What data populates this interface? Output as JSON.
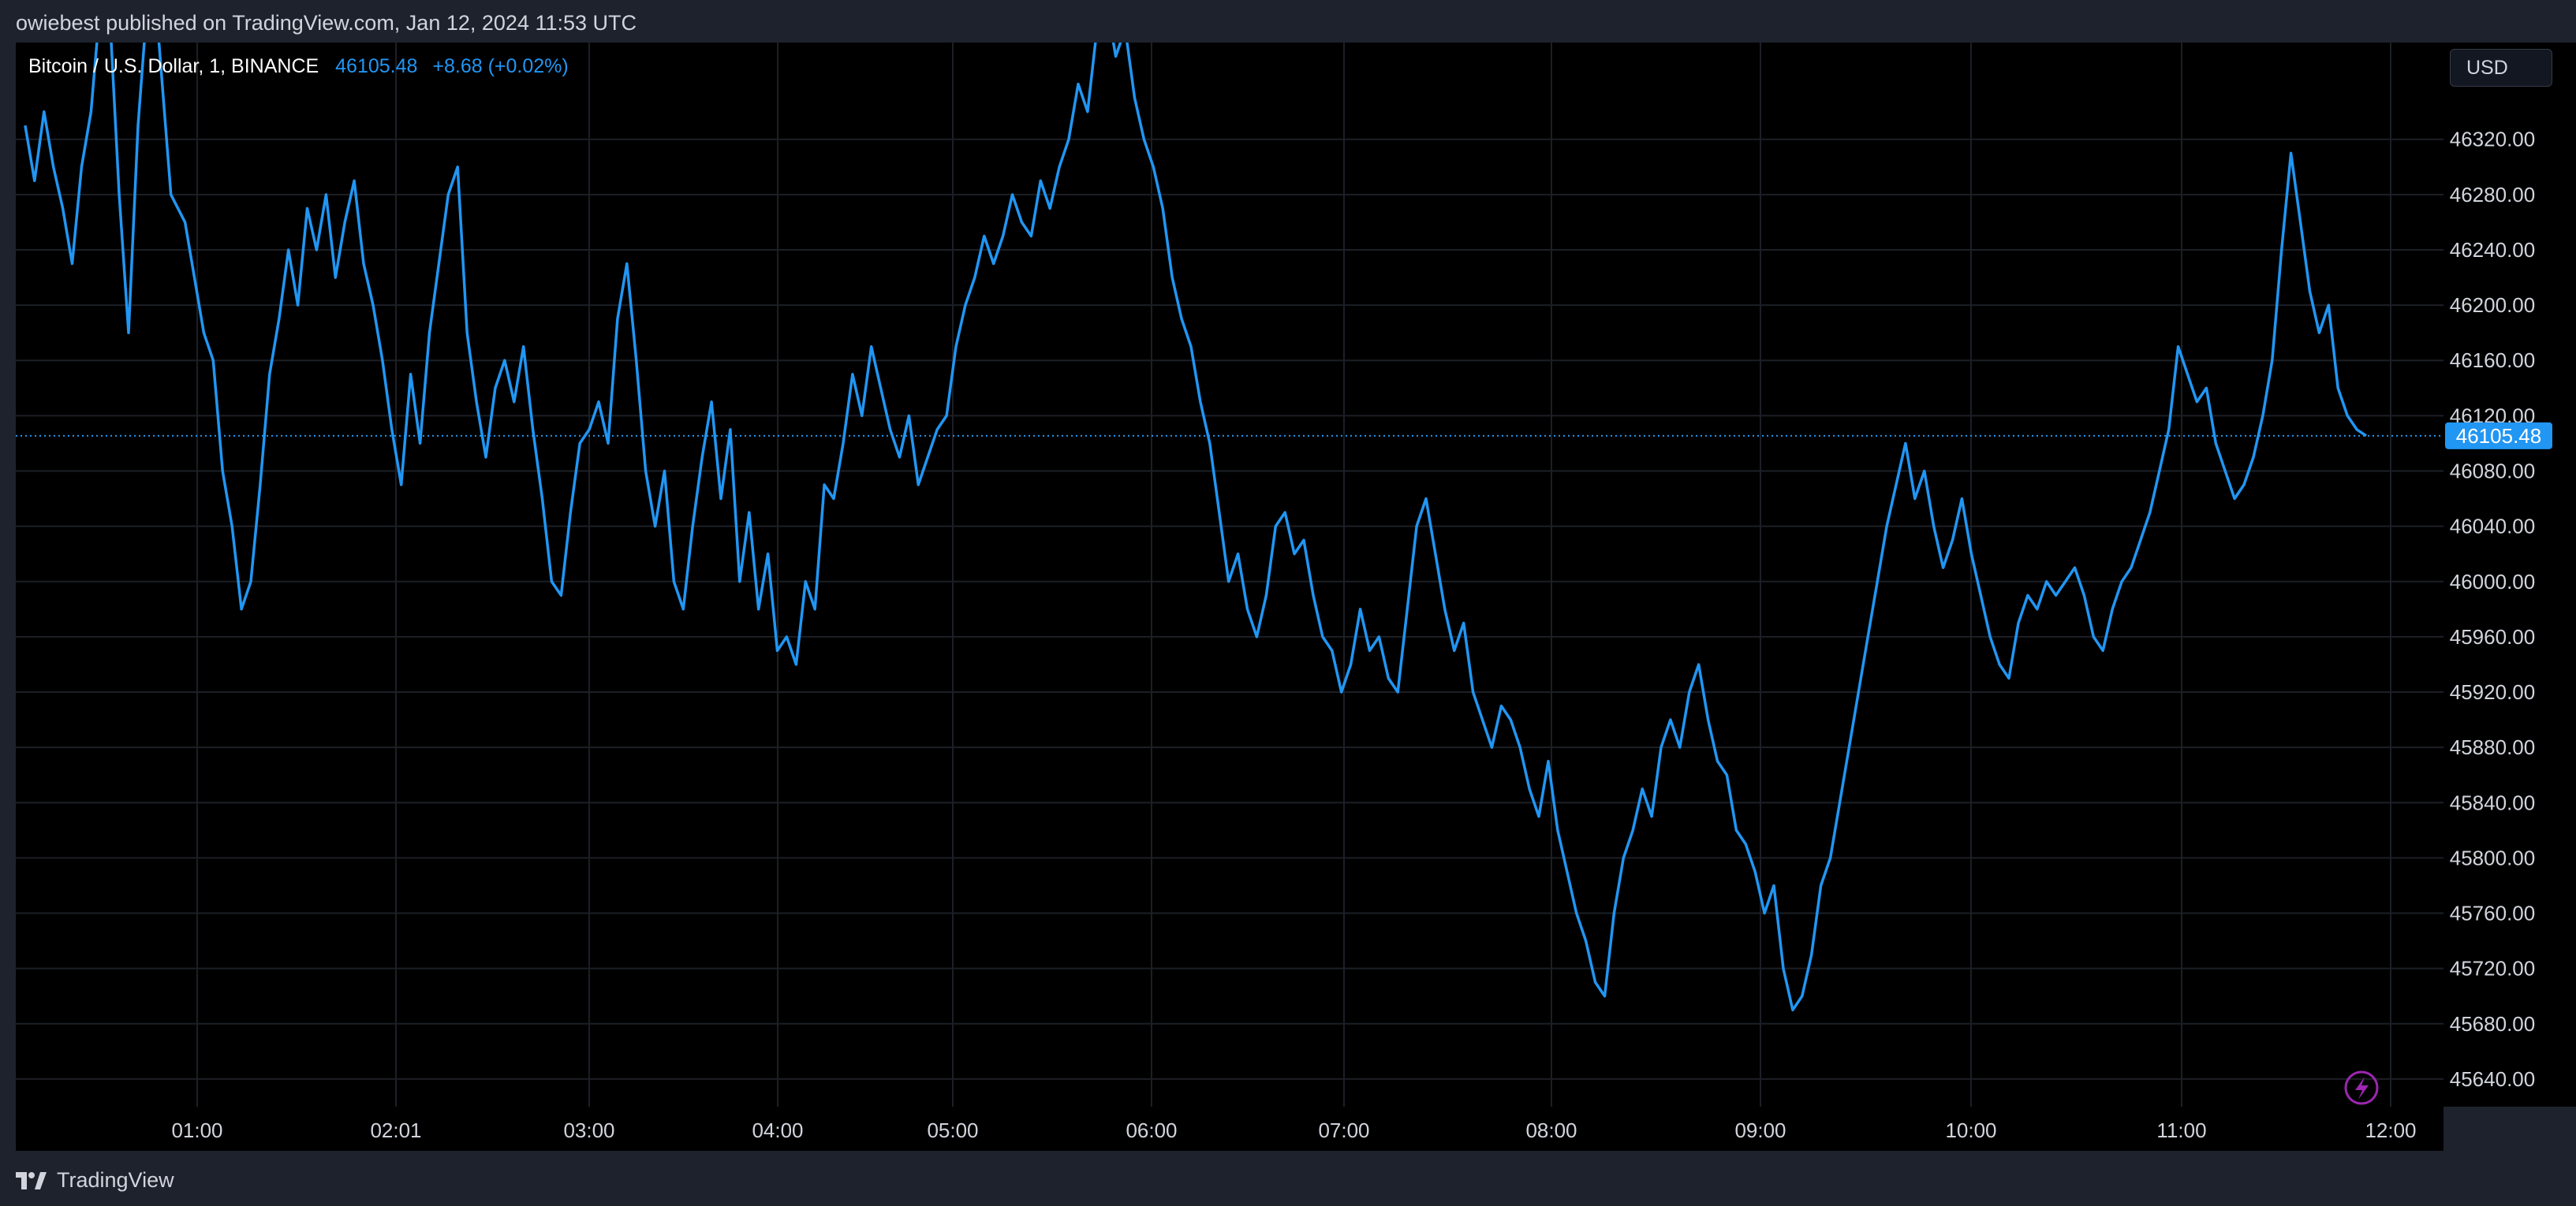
{
  "header": {
    "published": "owiebest published on TradingView.com, Jan 12, 2024 11:53 UTC"
  },
  "legend": {
    "symbol": "Bitcoin / U.S. Dollar, 1, BINANCE",
    "last": "46105.48",
    "change": "+8.68 (+0.02%)"
  },
  "currency_button": "USD",
  "footer": {
    "brand": "TradingView",
    "logo_icon": "tradingview-logo-icon"
  },
  "colors": {
    "line": "#2196f3",
    "grid": "#1c1f26",
    "background": "#000000",
    "badge": "#2196f3"
  },
  "chart_data": {
    "type": "line",
    "series": [
      {
        "values": [
          [
            0.02,
            46330
          ],
          [
            0.04,
            46290
          ],
          [
            0.06,
            46340
          ],
          [
            0.08,
            46300
          ],
          [
            0.1,
            46270
          ],
          [
            0.12,
            46230
          ],
          [
            0.14,
            46300
          ],
          [
            0.16,
            46340
          ],
          [
            0.18,
            46420
          ],
          [
            0.2,
            46410
          ],
          [
            0.22,
            46280
          ],
          [
            0.24,
            46180
          ],
          [
            0.26,
            46330
          ],
          [
            0.28,
            46420
          ],
          [
            0.3,
            46410
          ],
          [
            0.33,
            46280
          ],
          [
            0.36,
            46260
          ],
          [
            0.38,
            46220
          ],
          [
            0.4,
            46180
          ],
          [
            0.42,
            46160
          ],
          [
            0.44,
            46080
          ],
          [
            0.46,
            46040
          ],
          [
            0.48,
            45980
          ],
          [
            0.5,
            46000
          ],
          [
            0.52,
            46070
          ],
          [
            0.54,
            46150
          ],
          [
            0.56,
            46190
          ],
          [
            0.58,
            46240
          ],
          [
            0.6,
            46200
          ],
          [
            0.62,
            46270
          ],
          [
            0.64,
            46240
          ],
          [
            0.66,
            46280
          ],
          [
            0.68,
            46220
          ],
          [
            0.7,
            46260
          ],
          [
            0.72,
            46290
          ],
          [
            0.74,
            46230
          ],
          [
            0.76,
            46200
          ],
          [
            0.78,
            46160
          ],
          [
            0.8,
            46110
          ],
          [
            0.82,
            46070
          ],
          [
            0.84,
            46150
          ],
          [
            0.86,
            46100
          ],
          [
            0.88,
            46180
          ],
          [
            0.9,
            46230
          ],
          [
            0.92,
            46280
          ],
          [
            0.94,
            46300
          ],
          [
            0.96,
            46180
          ],
          [
            0.98,
            46130
          ],
          [
            1.0,
            46090
          ],
          [
            1.02,
            46140
          ],
          [
            1.04,
            46160
          ],
          [
            1.06,
            46130
          ],
          [
            1.08,
            46170
          ],
          [
            1.1,
            46110
          ],
          [
            1.12,
            46060
          ],
          [
            1.14,
            46000
          ],
          [
            1.16,
            45990
          ],
          [
            1.18,
            46050
          ],
          [
            1.2,
            46100
          ],
          [
            1.22,
            46110
          ],
          [
            1.24,
            46130
          ],
          [
            1.26,
            46100
          ],
          [
            1.28,
            46190
          ],
          [
            1.3,
            46230
          ],
          [
            1.32,
            46160
          ],
          [
            1.34,
            46080
          ],
          [
            1.36,
            46040
          ],
          [
            1.38,
            46080
          ],
          [
            1.4,
            46000
          ],
          [
            1.42,
            45980
          ],
          [
            1.44,
            46040
          ],
          [
            1.46,
            46090
          ],
          [
            1.48,
            46130
          ],
          [
            1.5,
            46060
          ],
          [
            1.52,
            46110
          ],
          [
            1.54,
            46000
          ],
          [
            1.56,
            46050
          ],
          [
            1.58,
            45980
          ],
          [
            1.6,
            46020
          ],
          [
            1.62,
            45950
          ],
          [
            1.64,
            45960
          ],
          [
            1.66,
            45940
          ],
          [
            1.68,
            46000
          ],
          [
            1.7,
            45980
          ],
          [
            1.72,
            46070
          ],
          [
            1.74,
            46060
          ],
          [
            1.76,
            46100
          ],
          [
            1.78,
            46150
          ],
          [
            1.8,
            46120
          ],
          [
            1.82,
            46170
          ],
          [
            1.84,
            46140
          ],
          [
            1.86,
            46110
          ],
          [
            1.88,
            46090
          ],
          [
            1.9,
            46120
          ],
          [
            1.92,
            46070
          ],
          [
            1.94,
            46090
          ],
          [
            1.96,
            46110
          ],
          [
            1.98,
            46120
          ],
          [
            2.0,
            46170
          ],
          [
            2.02,
            46200
          ],
          [
            2.04,
            46220
          ],
          [
            2.06,
            46250
          ],
          [
            2.08,
            46230
          ],
          [
            2.1,
            46250
          ],
          [
            2.12,
            46280
          ],
          [
            2.14,
            46260
          ],
          [
            2.16,
            46250
          ],
          [
            2.18,
            46290
          ],
          [
            2.2,
            46270
          ],
          [
            2.22,
            46300
          ],
          [
            2.24,
            46320
          ],
          [
            2.26,
            46360
          ],
          [
            2.28,
            46340
          ],
          [
            2.3,
            46400
          ],
          [
            2.32,
            46420
          ],
          [
            2.34,
            46380
          ],
          [
            2.36,
            46400
          ],
          [
            2.38,
            46350
          ],
          [
            2.4,
            46320
          ],
          [
            2.42,
            46300
          ],
          [
            2.44,
            46270
          ],
          [
            2.46,
            46220
          ],
          [
            2.48,
            46190
          ],
          [
            2.5,
            46170
          ],
          [
            2.52,
            46130
          ],
          [
            2.54,
            46100
          ],
          [
            2.56,
            46050
          ],
          [
            2.58,
            46000
          ],
          [
            2.6,
            46020
          ],
          [
            2.62,
            45980
          ],
          [
            2.64,
            45960
          ],
          [
            2.66,
            45990
          ],
          [
            2.68,
            46040
          ],
          [
            2.7,
            46050
          ],
          [
            2.72,
            46020
          ],
          [
            2.74,
            46030
          ],
          [
            2.76,
            45990
          ],
          [
            2.78,
            45960
          ],
          [
            2.8,
            45950
          ],
          [
            2.82,
            45920
          ],
          [
            2.84,
            45940
          ],
          [
            2.86,
            45980
          ],
          [
            2.88,
            45950
          ],
          [
            2.9,
            45960
          ],
          [
            2.92,
            45930
          ],
          [
            2.94,
            45920
          ],
          [
            2.96,
            45980
          ],
          [
            2.98,
            46040
          ],
          [
            3.0,
            46060
          ],
          [
            3.02,
            46020
          ],
          [
            3.04,
            45980
          ],
          [
            3.06,
            45950
          ],
          [
            3.08,
            45970
          ],
          [
            3.1,
            45920
          ],
          [
            3.12,
            45900
          ],
          [
            3.14,
            45880
          ],
          [
            3.16,
            45910
          ],
          [
            3.18,
            45900
          ],
          [
            3.2,
            45880
          ],
          [
            3.22,
            45850
          ],
          [
            3.24,
            45830
          ],
          [
            3.26,
            45870
          ],
          [
            3.28,
            45820
          ],
          [
            3.3,
            45790
          ],
          [
            3.32,
            45760
          ],
          [
            3.34,
            45740
          ],
          [
            3.36,
            45710
          ],
          [
            3.38,
            45700
          ],
          [
            3.4,
            45760
          ],
          [
            3.42,
            45800
          ],
          [
            3.44,
            45820
          ],
          [
            3.46,
            45850
          ],
          [
            3.48,
            45830
          ],
          [
            3.5,
            45880
          ],
          [
            3.52,
            45900
          ],
          [
            3.54,
            45880
          ],
          [
            3.56,
            45920
          ],
          [
            3.58,
            45940
          ],
          [
            3.6,
            45900
          ],
          [
            3.62,
            45870
          ],
          [
            3.64,
            45860
          ],
          [
            3.66,
            45820
          ],
          [
            3.68,
            45810
          ],
          [
            3.7,
            45790
          ],
          [
            3.72,
            45760
          ],
          [
            3.74,
            45780
          ],
          [
            3.76,
            45720
          ],
          [
            3.78,
            45690
          ],
          [
            3.8,
            45700
          ],
          [
            3.82,
            45730
          ],
          [
            3.84,
            45780
          ],
          [
            3.86,
            45800
          ],
          [
            3.88,
            45840
          ],
          [
            3.9,
            45880
          ],
          [
            3.92,
            45920
          ],
          [
            3.94,
            45960
          ],
          [
            3.96,
            46000
          ],
          [
            3.98,
            46040
          ],
          [
            4.0,
            46070
          ],
          [
            4.02,
            46100
          ],
          [
            4.04,
            46060
          ],
          [
            4.06,
            46080
          ],
          [
            4.08,
            46040
          ],
          [
            4.1,
            46010
          ],
          [
            4.12,
            46030
          ],
          [
            4.14,
            46060
          ],
          [
            4.16,
            46020
          ],
          [
            4.18,
            45990
          ],
          [
            4.2,
            45960
          ],
          [
            4.22,
            45940
          ],
          [
            4.24,
            45930
          ],
          [
            4.26,
            45970
          ],
          [
            4.28,
            45990
          ],
          [
            4.3,
            45980
          ],
          [
            4.32,
            46000
          ],
          [
            4.34,
            45990
          ],
          [
            4.36,
            46000
          ],
          [
            4.38,
            46010
          ],
          [
            4.4,
            45990
          ],
          [
            4.42,
            45960
          ],
          [
            4.44,
            45950
          ],
          [
            4.46,
            45980
          ],
          [
            4.48,
            46000
          ],
          [
            4.5,
            46010
          ],
          [
            4.52,
            46030
          ],
          [
            4.54,
            46050
          ],
          [
            4.56,
            46080
          ],
          [
            4.58,
            46110
          ],
          [
            4.6,
            46170
          ],
          [
            4.62,
            46150
          ],
          [
            4.64,
            46130
          ],
          [
            4.66,
            46140
          ],
          [
            4.68,
            46100
          ],
          [
            4.7,
            46080
          ],
          [
            4.72,
            46060
          ],
          [
            4.74,
            46070
          ],
          [
            4.76,
            46090
          ],
          [
            4.78,
            46120
          ],
          [
            4.8,
            46160
          ],
          [
            4.82,
            46240
          ],
          [
            4.84,
            46310
          ],
          [
            4.86,
            46260
          ],
          [
            4.88,
            46210
          ],
          [
            4.9,
            46180
          ],
          [
            4.92,
            46200
          ],
          [
            4.94,
            46140
          ],
          [
            4.96,
            46120
          ],
          [
            4.98,
            46110
          ],
          [
            5.0,
            46105.48
          ]
        ]
      }
    ],
    "x_ticks": [
      "01:00",
      "02:01",
      "03:00",
      "04:00",
      "05:00",
      "06:00",
      "07:00",
      "08:00",
      "09:00",
      "10:00",
      "11:00",
      "12:00"
    ],
    "y_ticks": [
      46320,
      46280,
      46240,
      46200,
      46160,
      46120,
      46080,
      46040,
      46000,
      45960,
      45920,
      45880,
      45840,
      45800,
      45760,
      45720,
      45680,
      45640
    ],
    "last_price_label": "46105.48",
    "ylim": [
      45620,
      46390
    ],
    "grid": true
  }
}
